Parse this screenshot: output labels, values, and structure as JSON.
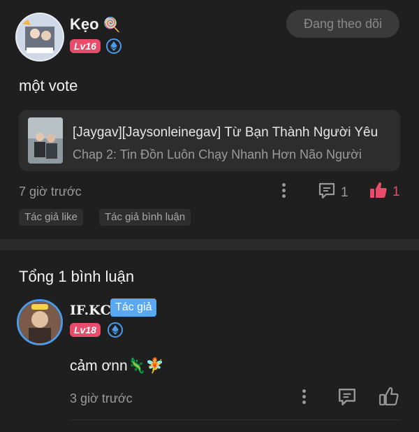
{
  "post": {
    "author_name": "Kẹo",
    "author_emoji": "🍭",
    "author_level": "Lv16",
    "follow_label": "Đang theo dõi",
    "content": "một vote",
    "story": {
      "title": "[Jaygav][Jaysonleinegav] Từ Bạn Thành Người Yêu",
      "chapter": "Chap 2: Tin Đồn Luôn Chạy Nhanh Hơn Não Người"
    },
    "time": "7 giờ trước",
    "comment_count": "1",
    "like_count": "1",
    "tags": [
      "Tác giả like",
      "Tác giả bình luận"
    ]
  },
  "comments_section": {
    "header": "Tổng 1 bình luận",
    "comments": [
      {
        "author_name": "IF.ΚϹ",
        "author_badge": "Tác giả",
        "author_level": "Lv18",
        "text": "cảm ơnn🦎🧚",
        "time": "3 giờ trước"
      }
    ]
  },
  "colors": {
    "background": "#1f1f1f",
    "accent_like": "#e94b6b",
    "level_badge": "#e94b6b",
    "author_badge": "#5aa9f0",
    "eth_badge": "#4d9be8"
  },
  "icons": [
    "ethereum-icon",
    "more-vertical-icon",
    "comment-icon",
    "thumbs-up-icon"
  ]
}
